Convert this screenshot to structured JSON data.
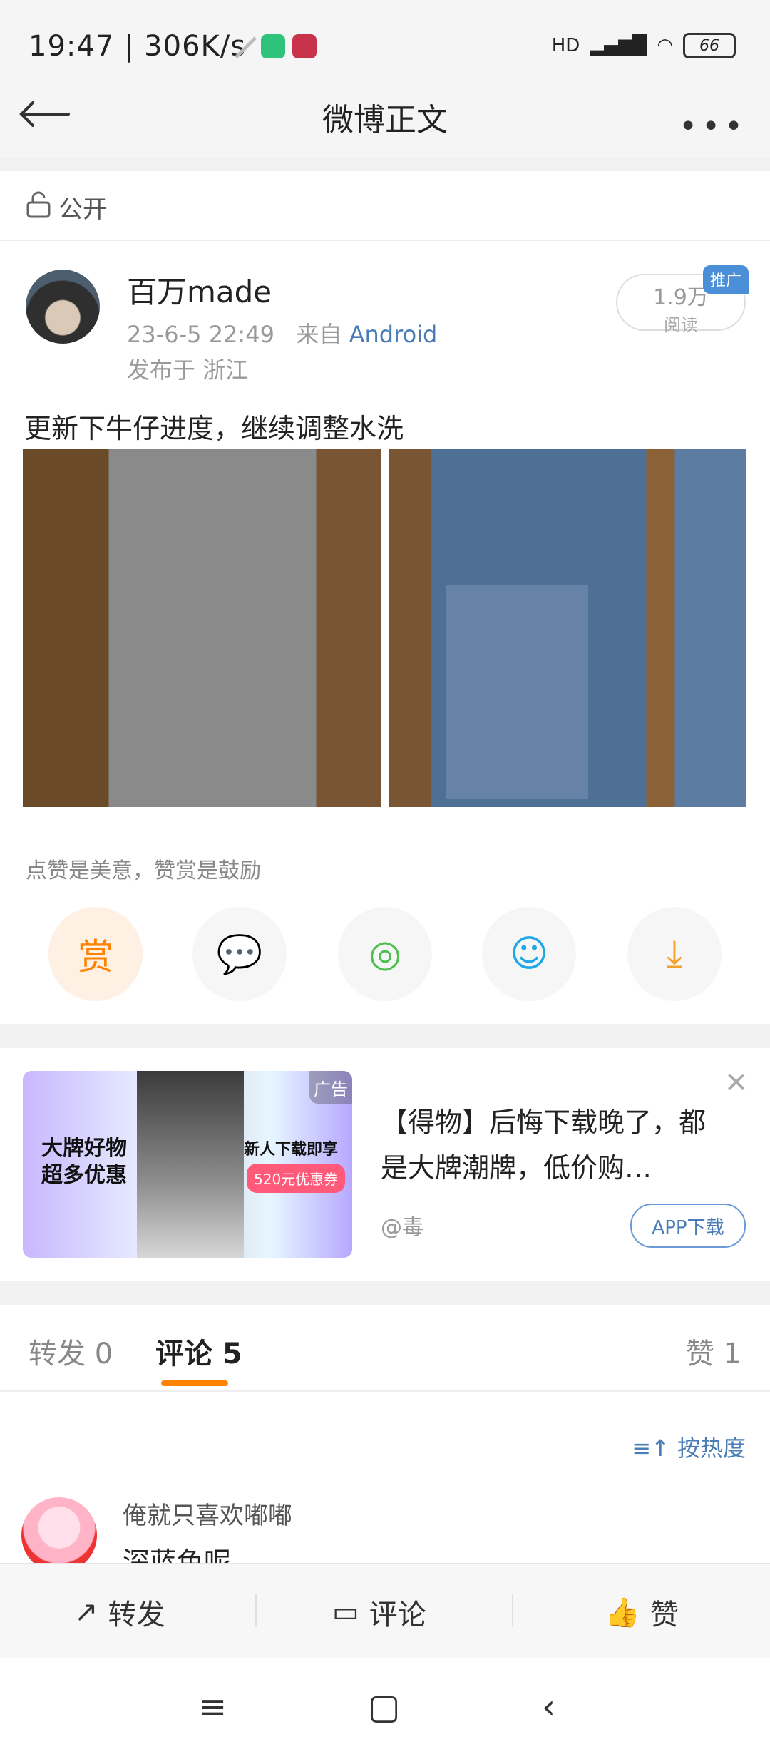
{
  "status_bar": {
    "time": "19:47 | 306K/s",
    "battery": "66",
    "network": "HD"
  },
  "header": {
    "title": "微博正文"
  },
  "visibility": {
    "label": "公开"
  },
  "post": {
    "author": "百万made",
    "date": "23-6-5 22:49",
    "from_prefix": "来自",
    "source": "Android",
    "location": "发布于 浙江",
    "reads_count": "1.9万",
    "reads_label": "阅读",
    "promo_tag": "推广",
    "text": "更新下牛仔进度，继续调整水洗"
  },
  "reward_tip": "点赞是美意，赞赏是鼓励",
  "share": {
    "reward_label": "赏"
  },
  "ad": {
    "tag": "广告",
    "left_text": "大牌好物超多优惠",
    "right_text": "新人下载即享",
    "coupon": "520元优惠券",
    "title": "【得物】后悔下载晚了，都是大牌潮牌，低价购…",
    "source": "@毒",
    "button": "APP下载"
  },
  "tabs": {
    "repost": "转发 0",
    "comment": "评论 5",
    "like": "赞 1"
  },
  "sort_label": "按热度",
  "comment": {
    "user": "俺就只喜欢嘟嘟",
    "text": "深蓝色呢"
  },
  "action_bar": {
    "repost": "转发",
    "comment": "评论",
    "like": "赞"
  }
}
